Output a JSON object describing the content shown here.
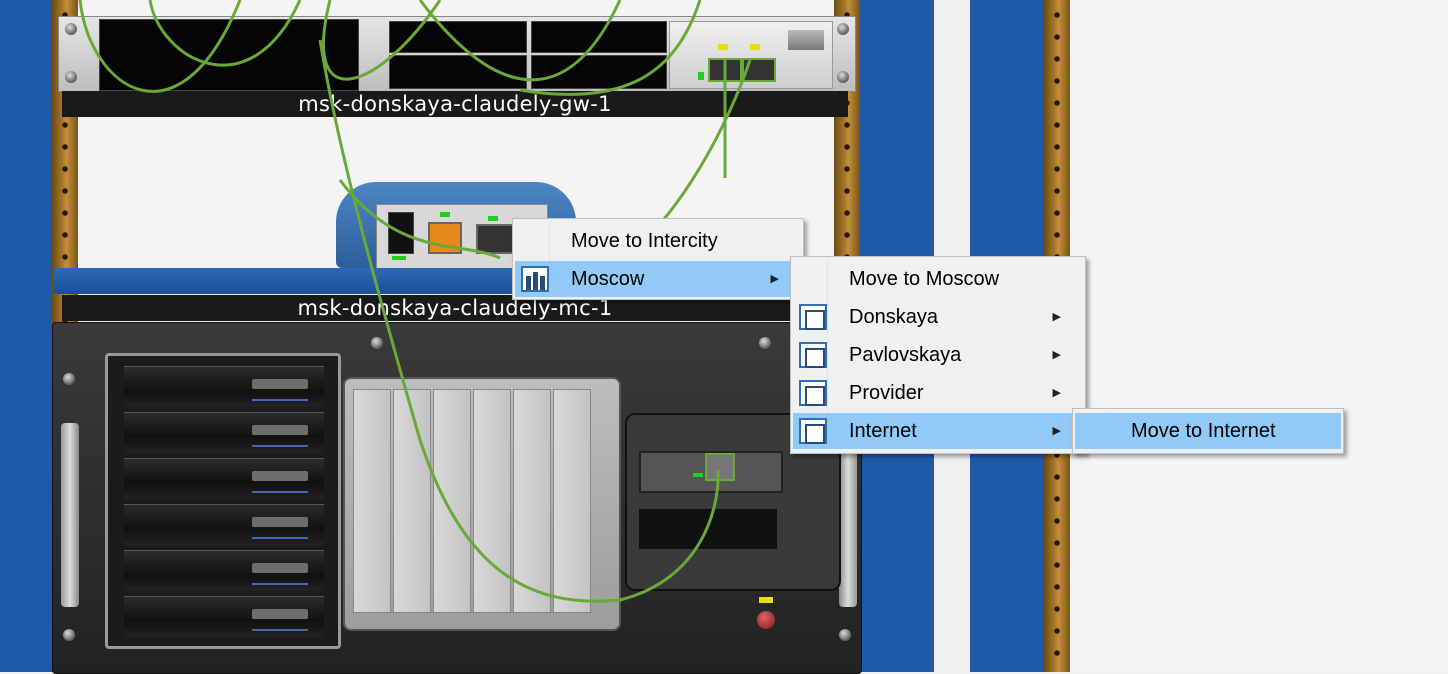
{
  "devices": {
    "gateway_label": "msk-donskaya-claudely-gw-1",
    "media_converter_label": "msk-donskaya-claudely-mc-1"
  },
  "context_menu": {
    "items": [
      {
        "label": "Move to Intercity"
      },
      {
        "label": "Moscow",
        "icon": "city-icon",
        "has_submenu": true,
        "highlighted": true
      }
    ]
  },
  "moscow_submenu": {
    "items": [
      {
        "label": "Move to Moscow"
      },
      {
        "label": "Donskaya",
        "icon": "building-icon",
        "has_submenu": true
      },
      {
        "label": "Pavlovskaya",
        "icon": "building-icon",
        "has_submenu": true
      },
      {
        "label": "Provider",
        "icon": "building-icon",
        "has_submenu": true
      },
      {
        "label": "Internet",
        "icon": "building-icon",
        "has_submenu": true,
        "highlighted": true
      }
    ]
  },
  "internet_submenu": {
    "items": [
      {
        "label": "Move to Internet",
        "highlighted": true
      }
    ]
  },
  "colors": {
    "rack_blue": "#1f5aa8",
    "menu_highlight": "#91c9f7",
    "cable_green": "#6aa838"
  }
}
